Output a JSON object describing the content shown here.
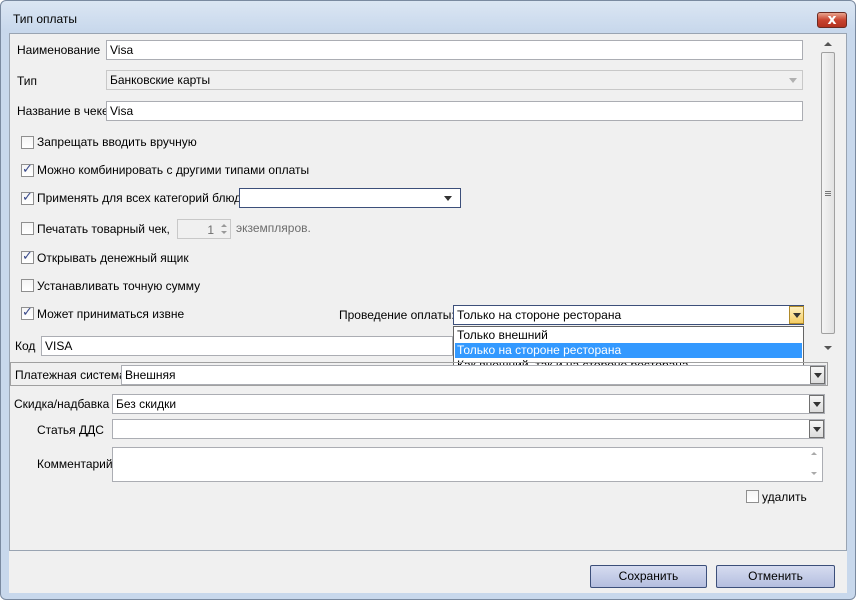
{
  "window": {
    "title": "Тип оплаты",
    "close_glyph": "x"
  },
  "form": {
    "name_label": "Наименование",
    "name_value": "Visa",
    "type_label": "Тип",
    "type_value": "Банковские карты",
    "receipt_name_label": "Название в чеке",
    "receipt_name_value": "Visa",
    "checkboxes": [
      {
        "label": "Запрещать вводить вручную",
        "checked": false
      },
      {
        "label": "Можно комбинировать с другими типами оплаты",
        "checked": true
      },
      {
        "label": "Применять для всех категорий блюд",
        "checked": true
      },
      {
        "label": "Печатать товарный чек,",
        "checked": false
      },
      {
        "label": "Открывать денежный ящик",
        "checked": true
      },
      {
        "label": "Устанавливать точную сумму",
        "checked": false
      },
      {
        "label": "Может приниматься извне",
        "checked": true
      }
    ],
    "copies_value": "1",
    "copies_suffix": "экземпляров.",
    "category_dropdown_value": "",
    "processing_label": "Проведение оплаты:",
    "processing_value": "Только на стороне ресторана",
    "processing_options": [
      "Только внешний",
      "Только на стороне ресторана",
      "Как внешний, так и на стороне ресторана"
    ],
    "processing_selected_index": 1,
    "code_label": "Код",
    "code_value": "VISA",
    "payment_system_label": "Платежная система:",
    "payment_system_value": "Внешняя",
    "discount_label": "Скидка/надбавка",
    "discount_value": "Без скидки",
    "cashflow_label": "Статья ДДС",
    "cashflow_value": "",
    "comment_label": "Комментарий",
    "comment_value": "",
    "delete_label": "удалить",
    "delete_checked": false,
    "check_glyph": "✓"
  },
  "buttons": {
    "save": "Сохранить",
    "cancel": "Отменить"
  },
  "colors": {
    "selection": "#3399ff",
    "accent_border": "#3c4f7a"
  }
}
